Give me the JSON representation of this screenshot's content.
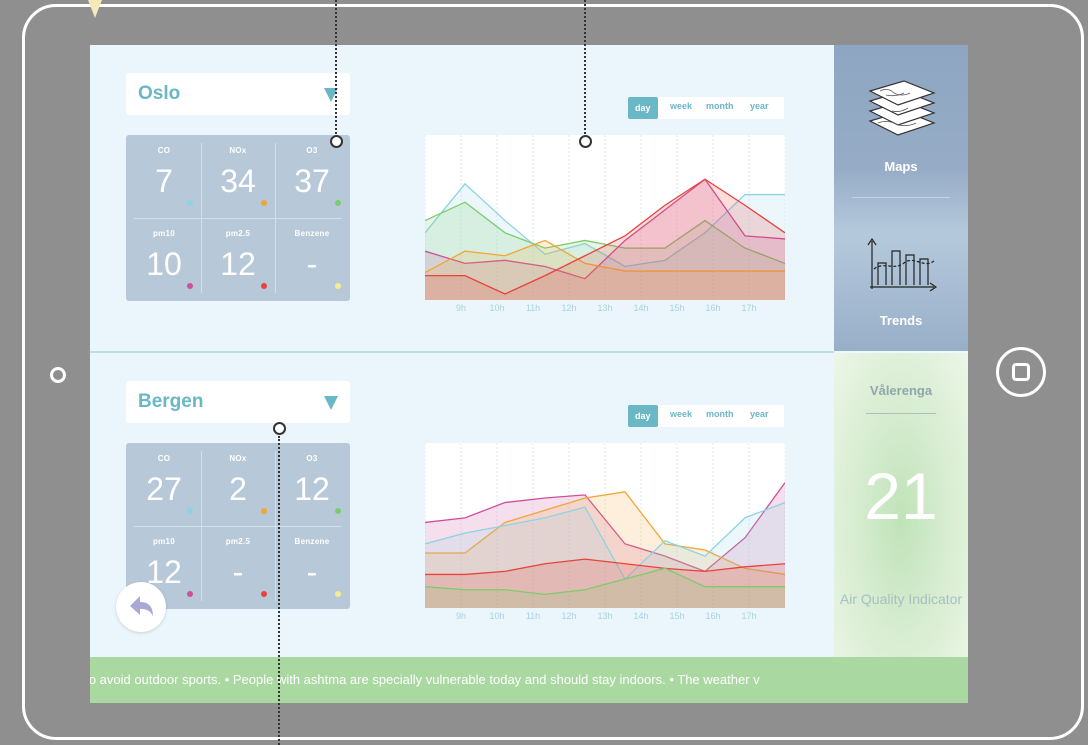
{
  "colors": {
    "accent": "#6ab7c6",
    "panel": "#b7c8d8",
    "co": "#8ed3e3",
    "nox": "#f2a536",
    "o3": "#7ccc6a",
    "pm10": "#cc4f9a",
    "pm25": "#e8423c",
    "benzene": "#f3ee8f"
  },
  "range_tabs": [
    "day",
    "week",
    "month",
    "year"
  ],
  "x_hours": [
    "9h",
    "10h",
    "11h",
    "12h",
    "13h",
    "14h",
    "15h",
    "16h",
    "17h"
  ],
  "cities": [
    {
      "name": "Oslo",
      "metrics": [
        {
          "label": "CO",
          "value": "7",
          "color": "#8ed3e3"
        },
        {
          "label": "NOx",
          "value": "34",
          "color": "#f2a536"
        },
        {
          "label": "O3",
          "value": "37",
          "color": "#7ccc6a"
        },
        {
          "label": "pm10",
          "value": "10",
          "color": "#cc4f9a"
        },
        {
          "label": "pm2.5",
          "value": "12",
          "color": "#e8423c"
        },
        {
          "label": "Benzene",
          "value": "-",
          "color": "#f3ee8f"
        }
      ]
    },
    {
      "name": "Bergen",
      "metrics": [
        {
          "label": "CO",
          "value": "27",
          "color": "#8ed3e3"
        },
        {
          "label": "NOx",
          "value": "2",
          "color": "#f2a536"
        },
        {
          "label": "O3",
          "value": "12",
          "color": "#7ccc6a"
        },
        {
          "label": "pm10",
          "value": "12",
          "color": "#cc4f9a"
        },
        {
          "label": "pm2.5",
          "value": "-",
          "color": "#e8423c"
        },
        {
          "label": "Benzene",
          "value": "-",
          "color": "#f3ee8f"
        }
      ]
    }
  ],
  "sidebar": {
    "maps_label": "Maps",
    "trends_label": "Trends"
  },
  "indicator": {
    "area": "Vålerenga",
    "value": "21",
    "label": "Air Quality Indicator"
  },
  "ticker_text": "t to avoid outdoor sports. • People with ashtma are specially vulnerable today and should stay indoors. • The weather v",
  "chart_data": [
    {
      "type": "area",
      "x": [
        "9h",
        "10h",
        "11h",
        "12h",
        "13h",
        "14h",
        "15h",
        "16h",
        "17h"
      ],
      "ylim": [
        0,
        100
      ],
      "series": [
        {
          "color": "#8ed3e3",
          "values": [
            40,
            72,
            48,
            26,
            33,
            18,
            22,
            40,
            65,
            65
          ]
        },
        {
          "color": "#7ccc6a",
          "values": [
            48,
            60,
            40,
            30,
            35,
            30,
            30,
            48,
            30,
            20
          ]
        },
        {
          "color": "#cc4f9a",
          "values": [
            28,
            20,
            22,
            18,
            10,
            35,
            55,
            75,
            38,
            36
          ]
        },
        {
          "color": "#f2a536",
          "values": [
            14,
            28,
            25,
            35,
            20,
            15,
            15,
            15,
            15,
            15
          ]
        },
        {
          "color": "#e8423c",
          "values": [
            12,
            12,
            0,
            12,
            25,
            38,
            58,
            75,
            58,
            40
          ]
        }
      ]
    },
    {
      "type": "area",
      "x": [
        "9h",
        "10h",
        "11h",
        "12h",
        "13h",
        "14h",
        "15h",
        "16h",
        "17h"
      ],
      "ylim": [
        0,
        100
      ],
      "series": [
        {
          "color": "#cc4f9a",
          "values": [
            52,
            55,
            65,
            68,
            70,
            38,
            30,
            20,
            42,
            78
          ]
        },
        {
          "color": "#f2a536",
          "values": [
            32,
            32,
            52,
            60,
            68,
            72,
            38,
            34,
            22,
            18
          ]
        },
        {
          "color": "#8ed3e3",
          "values": [
            38,
            45,
            50,
            55,
            62,
            15,
            40,
            30,
            55,
            65
          ]
        },
        {
          "color": "#e8423c",
          "values": [
            18,
            18,
            20,
            25,
            28,
            25,
            22,
            20,
            23,
            25
          ]
        },
        {
          "color": "#7ccc6a",
          "values": [
            10,
            8,
            8,
            5,
            8,
            15,
            22,
            10,
            10,
            10
          ]
        }
      ]
    }
  ]
}
